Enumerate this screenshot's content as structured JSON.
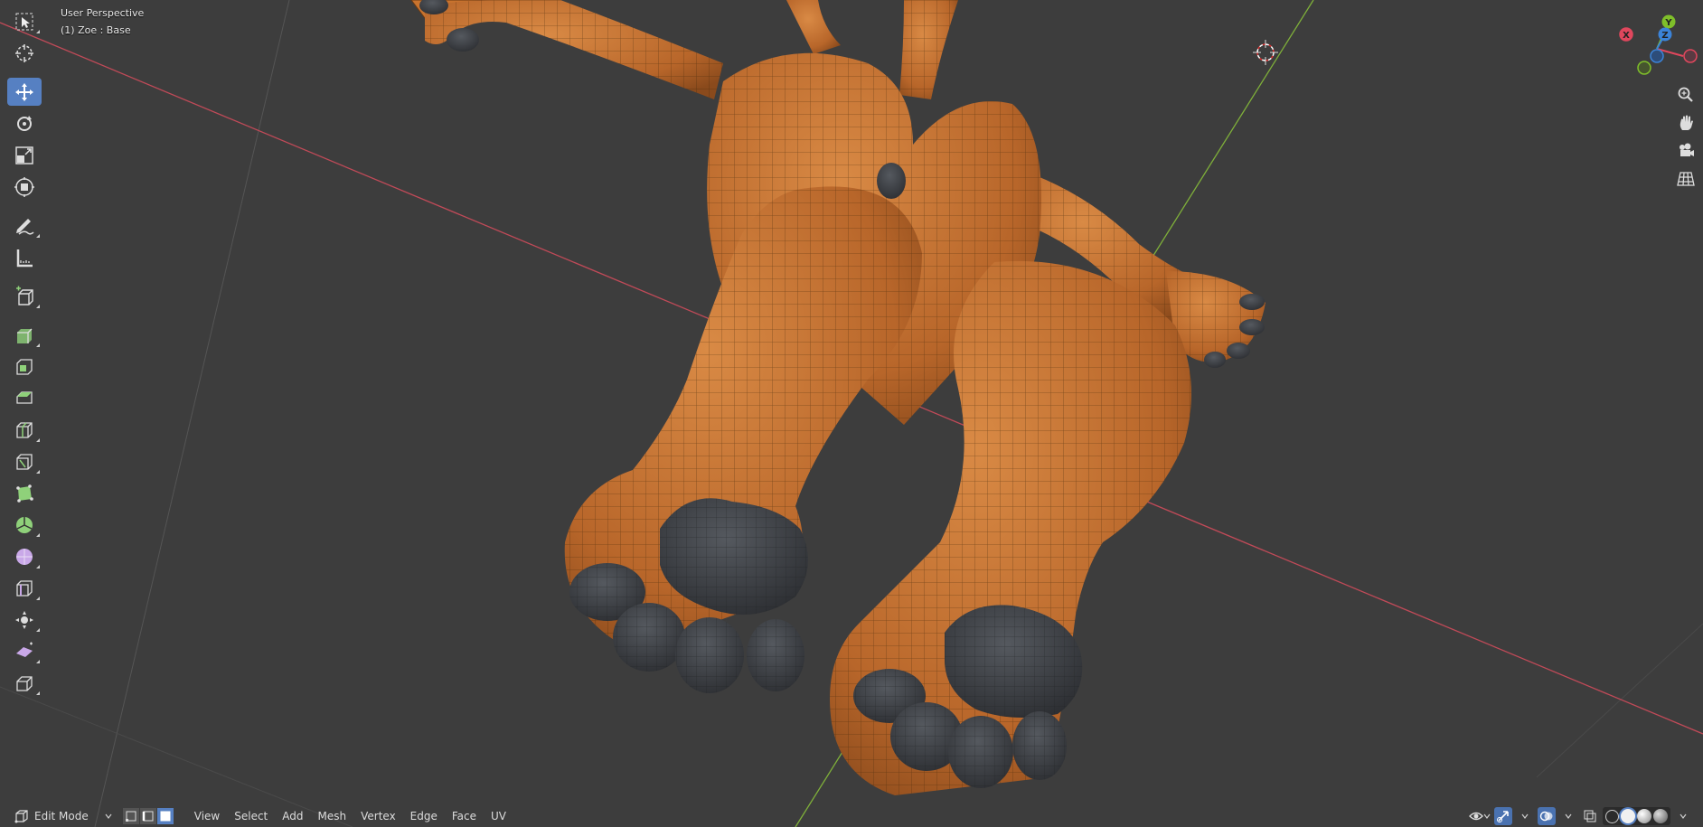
{
  "viewport": {
    "view_name": "User Perspective",
    "object_info": "(1) Zoe  : Base"
  },
  "toolbar": {
    "tools": [
      {
        "name": "select-box",
        "icon": "select-box-icon",
        "active": false
      },
      {
        "name": "cursor",
        "icon": "cursor-icon",
        "active": false
      },
      {
        "name": "move",
        "icon": "move-icon",
        "active": true
      },
      {
        "name": "rotate",
        "icon": "rotate-icon",
        "active": false
      },
      {
        "name": "scale",
        "icon": "scale-icon",
        "active": false
      },
      {
        "name": "transform",
        "icon": "transform-icon",
        "active": false
      },
      {
        "name": "annotate",
        "icon": "annotate-icon",
        "active": false
      },
      {
        "name": "measure",
        "icon": "measure-icon",
        "active": false
      },
      {
        "name": "add-cube",
        "icon": "add-cube-icon",
        "active": false
      },
      {
        "name": "extrude-region",
        "icon": "extrude-region-icon",
        "active": false
      },
      {
        "name": "inset-faces",
        "icon": "inset-faces-icon",
        "active": false
      },
      {
        "name": "bevel",
        "icon": "bevel-icon",
        "active": false
      },
      {
        "name": "loop-cut",
        "icon": "loop-cut-icon",
        "active": false
      },
      {
        "name": "knife",
        "icon": "knife-icon",
        "active": false
      },
      {
        "name": "poly-build",
        "icon": "poly-build-icon",
        "active": false
      },
      {
        "name": "spin",
        "icon": "spin-icon",
        "active": false
      },
      {
        "name": "smooth",
        "icon": "smooth-icon",
        "active": false
      },
      {
        "name": "edge-slide",
        "icon": "edge-slide-icon",
        "active": false
      },
      {
        "name": "shrink-fatten",
        "icon": "shrink-fatten-icon",
        "active": false
      },
      {
        "name": "shear",
        "icon": "shear-icon",
        "active": false
      },
      {
        "name": "rip-region",
        "icon": "rip-region-icon",
        "active": false
      }
    ]
  },
  "gizmo": {
    "x_label": "X",
    "y_label": "Y",
    "z_label": "Z",
    "x_color": "#e0475d",
    "y_color": "#7fbf2a",
    "z_color": "#3b83d8"
  },
  "header": {
    "mode": "Edit Mode",
    "menus": [
      "View",
      "Select",
      "Add",
      "Mesh",
      "Vertex",
      "Edge",
      "Face",
      "UV"
    ]
  },
  "colors": {
    "background": "#3d3d3d",
    "mesh_fur": "#c8732e",
    "mesh_pad": "#3e4146",
    "x_axis": "#c04a58",
    "y_axis": "#7fb03a",
    "active_tool": "#5680c2"
  }
}
